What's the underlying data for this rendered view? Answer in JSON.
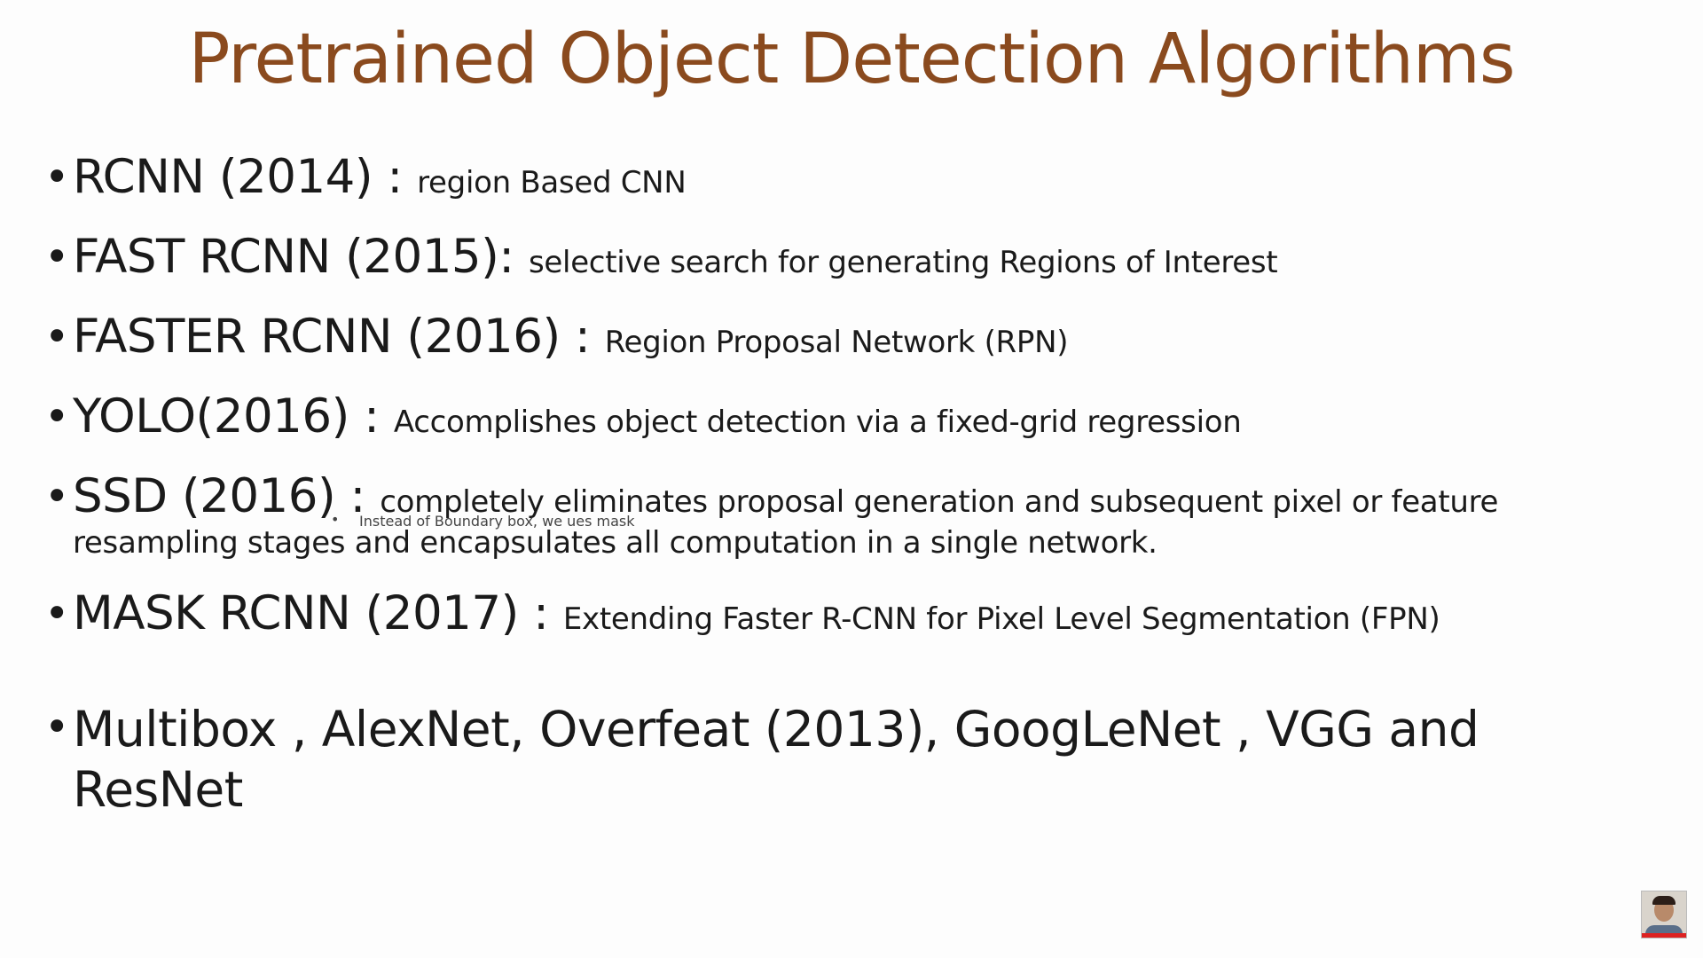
{
  "slide": {
    "title": "Pretrained Object Detection Algorithms",
    "bullet_symbol": "•",
    "items": [
      {
        "head": "RCNN (2014) : ",
        "desc": "region Based CNN"
      },
      {
        "head": "FAST RCNN (2015): ",
        "desc": "selective search for generating Regions of Interest"
      },
      {
        "head": "FASTER RCNN (2016) : ",
        "desc": "Region Proposal Network (RPN)"
      },
      {
        "head": "YOLO(2016) : ",
        "desc": "Accomplishes object detection via a fixed-grid regression"
      },
      {
        "head": "SSD (2016) : ",
        "desc": "completely eliminates proposal generation and subsequent pixel or feature",
        "desc_line2": "resampling stages and encapsulates all computation in a single network."
      },
      {
        "head": "MASK RCNN (2017) : ",
        "desc": "Extending Faster R-CNN for Pixel Level Segmentation (FPN)"
      },
      {
        "head": "Multibox , AlexNet, Overfeat (2013), GoogLeNet , VGG and",
        "head_line2": "ResNet"
      }
    ],
    "subnote": "Instead of Boundary box, we ues mask"
  },
  "presenter": {
    "icon": "webcam-thumbnail"
  }
}
